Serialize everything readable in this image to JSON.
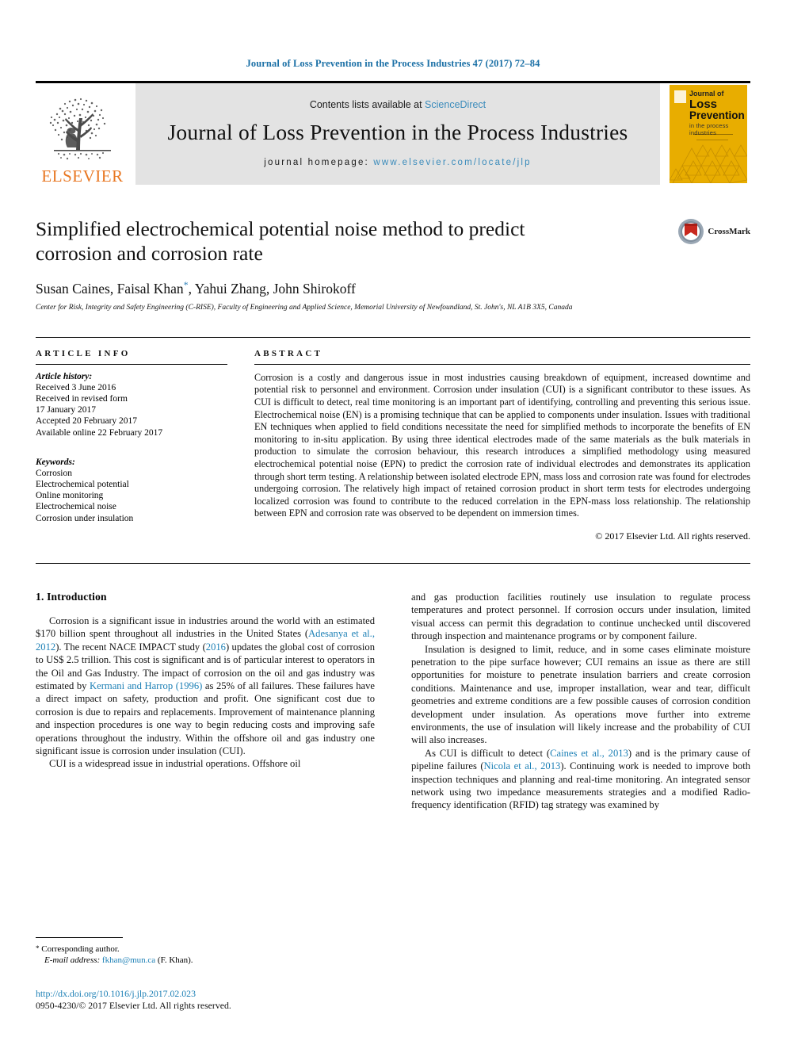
{
  "running_head": "Journal of Loss Prevention in the Process Industries 47 (2017) 72–84",
  "masthead": {
    "publisher_name": "ELSEVIER",
    "contents_prefix": "Contents lists available at ",
    "contents_link": "ScienceDirect",
    "journal_title": "Journal of Loss Prevention in the Process Industries",
    "homepage_label": "journal homepage: ",
    "homepage_url": "www.elsevier.com/locate/jlp",
    "cover": {
      "line1": "Journal of",
      "line2": "Loss",
      "line3": "Prevention",
      "line4": "in the process industries",
      "bg_color": "#e8ad00"
    }
  },
  "article": {
    "title": "Simplified electrochemical potential noise method to predict corrosion and corrosion rate",
    "authors": "Susan Caines, Faisal Khan",
    "authors_after_star": ", Yahui Zhang, John Shirokoff",
    "corresponding_marker": "*",
    "affiliation": "Center for Risk, Integrity and Safety Engineering (C-RISE), Faculty of Engineering and Applied Science, Memorial University of Newfoundland, St. John's, NL A1B 3X5, Canada",
    "crossmark_label": "CrossMark"
  },
  "article_info": {
    "heading": "ARTICLE INFO",
    "history_label": "Article history:",
    "history": [
      "Received 3 June 2016",
      "Received in revised form",
      "17 January 2017",
      "Accepted 20 February 2017",
      "Available online 22 February 2017"
    ],
    "keywords_label": "Keywords:",
    "keywords": [
      "Corrosion",
      "Electrochemical potential",
      "Online monitoring",
      "Electrochemical noise",
      "Corrosion under insulation"
    ]
  },
  "abstract": {
    "heading": "ABSTRACT",
    "text": "Corrosion is a costly and dangerous issue in most industries causing breakdown of equipment, increased downtime and potential risk to personnel and environment. Corrosion under insulation (CUI) is a significant contributor to these issues. As CUI is difficult to detect, real time monitoring is an important part of identifying, controlling and preventing this serious issue. Electrochemical noise (EN) is a promising technique that can be applied to components under insulation. Issues with traditional EN techniques when applied to field conditions necessitate the need for simplified methods to incorporate the benefits of EN monitoring to in-situ application. By using three identical electrodes made of the same materials as the bulk materials in production to simulate the corrosion behaviour, this research introduces a simplified methodology using measured electrochemical potential noise (EPN) to predict the corrosion rate of individual electrodes and demonstrates its application through short term testing. A relationship between isolated electrode EPN, mass loss and corrosion rate was found for electrodes undergoing corrosion. The relatively high impact of retained corrosion product in short term tests for electrodes undergoing localized corrosion was found to contribute to the reduced correlation in the EPN-mass loss relationship. The relationship between EPN and corrosion rate was observed to be dependent on immersion times.",
    "copyright": "© 2017 Elsevier Ltd. All rights reserved."
  },
  "body": {
    "section_number_title": "1. Introduction",
    "left_paragraphs": [
      {
        "segments": [
          {
            "t": "Corrosion is a significant issue in industries around the world with an estimated $170 billion spent throughout all industries in the United States (",
            "k": "plain"
          },
          {
            "t": "Adesanya et al., 2012",
            "k": "cite"
          },
          {
            "t": "). The recent NACE IMPACT study (",
            "k": "plain"
          },
          {
            "t": "2016",
            "k": "cite"
          },
          {
            "t": ") updates the global cost of corrosion to US$ 2.5 trillion. This cost is significant and is of particular interest to operators in the Oil and Gas Industry. The impact of corrosion on the oil and gas industry was estimated by ",
            "k": "plain"
          },
          {
            "t": "Kermani and Harrop (1996)",
            "k": "cite"
          },
          {
            "t": " as 25% of all failures. These failures have a direct impact on safety, production and profit. One significant cost due to corrosion is due to repairs and replacements. Improvement of maintenance planning and inspection procedures is one way to begin reducing costs and improving safe operations throughout the industry. Within the offshore oil and gas industry one significant issue is corrosion under insulation (CUI).",
            "k": "plain"
          }
        ]
      },
      {
        "segments": [
          {
            "t": "CUI is a widespread issue in industrial operations. Offshore oil",
            "k": "plain"
          }
        ]
      }
    ],
    "right_paragraphs": [
      {
        "indent": false,
        "segments": [
          {
            "t": "and gas production facilities routinely use insulation to regulate process temperatures and protect personnel. If corrosion occurs under insulation, limited visual access can permit this degradation to continue unchecked until discovered through inspection and maintenance programs or by component failure.",
            "k": "plain"
          }
        ]
      },
      {
        "indent": true,
        "segments": [
          {
            "t": "Insulation is designed to limit, reduce, and in some cases eliminate moisture penetration to the pipe surface however; CUI remains an issue as there are still opportunities for moisture to penetrate insulation barriers and create corrosion conditions. Maintenance and use, improper installation, wear and tear, difficult geometries and extreme conditions are a few possible causes of corrosion condition development under insulation. As operations move further into extreme environments, the use of insulation will likely increase and the probability of CUI will also increases.",
            "k": "plain"
          }
        ]
      },
      {
        "indent": true,
        "segments": [
          {
            "t": "As CUI is difficult to detect (",
            "k": "plain"
          },
          {
            "t": "Caines et al., 2013",
            "k": "cite"
          },
          {
            "t": ") and is the primary cause of pipeline failures (",
            "k": "plain"
          },
          {
            "t": "Nicola et al., 2013",
            "k": "cite"
          },
          {
            "t": "). Continuing work is needed to improve both inspection techniques and planning and real-time monitoring. An integrated sensor network using two impedance measurements strategies and a modified Radio-frequency identification (RFID) tag strategy was examined by",
            "k": "plain"
          }
        ]
      }
    ]
  },
  "footnote": {
    "corresponding": "Corresponding author.",
    "email_label": "E-mail address:",
    "email": "fkhan@mun.ca",
    "email_suffix": "(F. Khan).",
    "doi": "http://dx.doi.org/10.1016/j.jlp.2017.02.023",
    "issn_copyright": "0950-4230/© 2017 Elsevier Ltd. All rights reserved."
  },
  "colors": {
    "link": "#1b7fb5",
    "elsevier_orange": "#e87722",
    "banner_gray": "#e3e3e3"
  }
}
